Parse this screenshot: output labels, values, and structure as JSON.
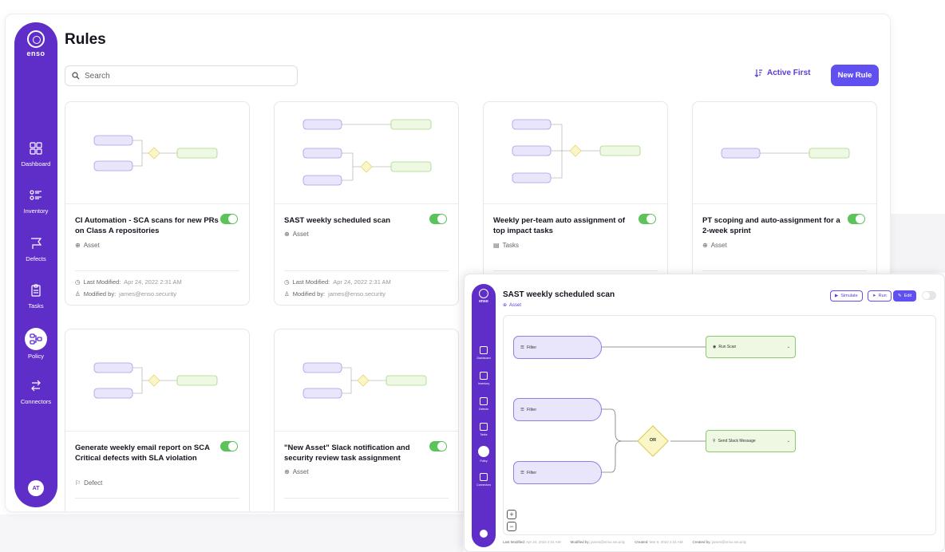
{
  "sidebar": {
    "logo": "enso",
    "items": [
      {
        "label": "Dashboard",
        "icon": "grid-icon"
      },
      {
        "label": "Inventory",
        "icon": "list-icon"
      },
      {
        "label": "Defects",
        "icon": "flag-icon"
      },
      {
        "label": "Tasks",
        "icon": "clipboard-icon"
      },
      {
        "label": "Policy",
        "icon": "flow-icon",
        "active": true
      },
      {
        "label": "Connectors",
        "icon": "connector-icon"
      }
    ],
    "avatar": "AT"
  },
  "page": {
    "title": "Rules"
  },
  "search": {
    "placeholder": "Search"
  },
  "toolbar": {
    "sort_label": "Active First",
    "new_rule_label": "New Rule"
  },
  "labels": {
    "last_modified": "Last Modified:",
    "modified_by": "Modified by:"
  },
  "cards": [
    {
      "title": "CI Automation - SCA scans for new PRs on Class A repositories",
      "type": "Asset",
      "last_modified": "Apr 24, 2022 2:31 AM",
      "modified_by": "james@enso.security",
      "enabled": true
    },
    {
      "title": "SAST weekly scheduled scan",
      "type": "Asset",
      "last_modified": "Apr 24, 2022 2:31 AM",
      "modified_by": "james@enso.security",
      "enabled": true
    },
    {
      "title": "Weekly per-team auto assignment of top impact tasks",
      "type": "Tasks",
      "enabled": true
    },
    {
      "title": "PT scoping and auto-assignment for a 2-week sprint",
      "type": "Asset",
      "enabled": true
    },
    {
      "title": "Generate weekly email report on SCA Critical defects with SLA violation",
      "type": "Defect",
      "enabled": true
    },
    {
      "title": "\"New Asset\" Slack notification and security review task assignment",
      "type": "Asset",
      "enabled": true
    }
  ],
  "detail": {
    "title": "SAST weekly scheduled scan",
    "type": "Asset",
    "buttons": {
      "simulate": "Simulate",
      "run": "Run",
      "edit": "Edit"
    },
    "nodes": {
      "filter1": "Filter",
      "filter2": "Filter",
      "filter3": "Filter",
      "or": "OR",
      "action1": "Run Scan",
      "action2": "Send Slack Message"
    },
    "footer": {
      "last_modified_label": "Last Modified:",
      "last_modified": "Apr 24, 2022 2:31 AM",
      "modified_by_label": "Modified by:",
      "modified_by": "james@enso.security",
      "created_label": "Created:",
      "created": "Mar 8, 2022 2:31 AM",
      "created_by_label": "Created by:",
      "created_by": "james@enso.security"
    },
    "sidebar": [
      "Dashboard",
      "Inventory",
      "Defects",
      "Tasks",
      "Policy",
      "Connectors"
    ]
  },
  "colors": {
    "brand": "#5f2ec9",
    "accent": "#6050ef",
    "toggle_on": "#5cc25a",
    "filter_node": "#e9e6fb",
    "action_node": "#eef8e3",
    "or_node": "#fbf6c8"
  }
}
